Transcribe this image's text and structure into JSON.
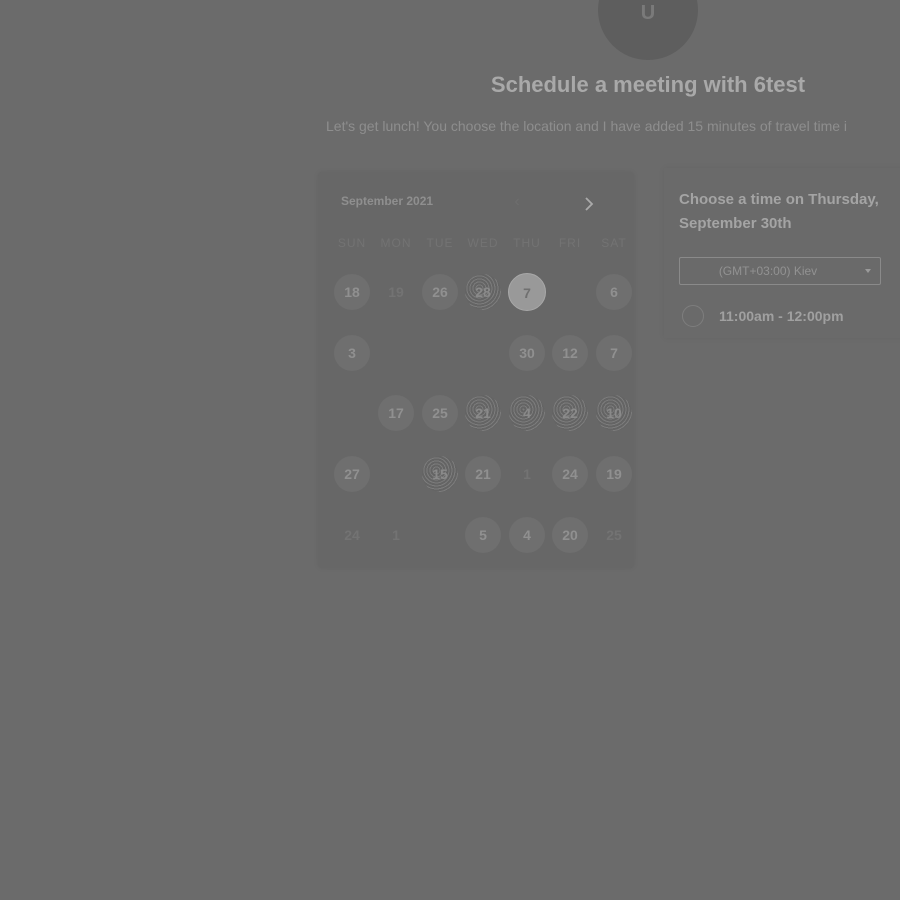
{
  "host": {
    "avatar_letter": "U"
  },
  "header": {
    "title": "Schedule a meeting with 6test",
    "subtitle": "Let's get lunch! You choose the location and I have added 15 minutes of travel time i"
  },
  "calendar": {
    "month_label": "September 2021",
    "prev_icon": "chevron-left-icon",
    "next_icon": "chevron-right-icon",
    "weekdays": [
      "SUN",
      "MON",
      "TUE",
      "WED",
      "THU",
      "FRI",
      "SAT"
    ],
    "weeks": [
      [
        "18",
        "19",
        "26",
        "28",
        "7",
        "",
        "6"
      ],
      [
        "3",
        "",
        "",
        "",
        "30",
        "12",
        "7"
      ],
      [
        "",
        "17",
        "25",
        "21",
        "4",
        "22",
        "10"
      ],
      [
        "27",
        "",
        "15",
        "21",
        "1",
        "24",
        "19"
      ],
      [
        "24",
        "1",
        "",
        "5",
        "4",
        "20",
        "25"
      ]
    ],
    "selected_date_label": "7"
  },
  "time_picker": {
    "heading": "Choose a time on Thursday, September 30th",
    "timezone": "(GMT+03:00) Kiev",
    "slots": [
      "11:00am - 12:00pm"
    ]
  }
}
